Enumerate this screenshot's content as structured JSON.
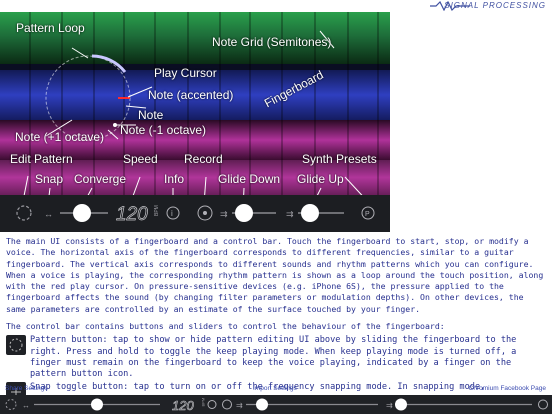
{
  "header": {
    "brand": "SIGNAL PROCESSING"
  },
  "hero": {
    "labels": {
      "pattern_loop": "Pattern Loop",
      "note_grid": "Note Grid (Semitones)",
      "play_cursor": "Play Cursor",
      "note_accented": "Note (accented)",
      "fingerboard": "Fingerboard",
      "note": "Note",
      "note_plus": "Note (+1 octave)",
      "note_minus": "Note (-1 octave)",
      "edit_pattern": "Edit Pattern",
      "speed": "Speed",
      "record": "Record",
      "synth_presets": "Synth Presets",
      "snap": "Snap",
      "converge": "Converge",
      "info": "Info",
      "glide_down": "Glide Down",
      "glide_up": "Glide Up"
    },
    "speed_value": "120",
    "speed_unit": "BPM"
  },
  "description": {
    "intro": "The main UI consists of a fingerboard and a control bar. Touch the fingerboard to start, stop, or modify a voice. The horizontal axis of the fingerboard corresponds to different frequencies, similar to a guitar fingerboard. The vertical axis corresponds to different sounds and rhythm patterns which you can configure. When a voice is playing, the corresponding rhythm pattern is shown as a loop around the touch position, along with the red play cursor. On pressure-sensitive devices (e.g. iPhone 6S), the pressure applied to the fingerboard affects the sound (by changing filter parameters or modulation depths). On other devices, the same parameters are controlled by an estimate of the surface touched by your finger.",
    "control_intro": "The control bar contains buttons and sliders to control the behaviour of the fingerboard:",
    "items": [
      {
        "icon": "pattern-icon",
        "text": "Pattern button: tap to show or hide pattern editing UI above by sliding the fingerboard to the right. Press and hold to toggle the keep playing mode. When keep playing mode is turned off, a finger must remain on the fingerboard to keep the voice playing, indicated by a finger on the pattern button icon."
      },
      {
        "icon": "snap-icon",
        "text": "Snap toggle button: tap to turn on or off the frequency snapping mode. In snapping mode,"
      }
    ]
  },
  "links": {
    "share": "Share Settings",
    "import": "Import Settings",
    "chromium": "Chromium Facebook Page"
  },
  "bottom_bar": {
    "speed_value": "120",
    "speed_unit": "BPM"
  }
}
